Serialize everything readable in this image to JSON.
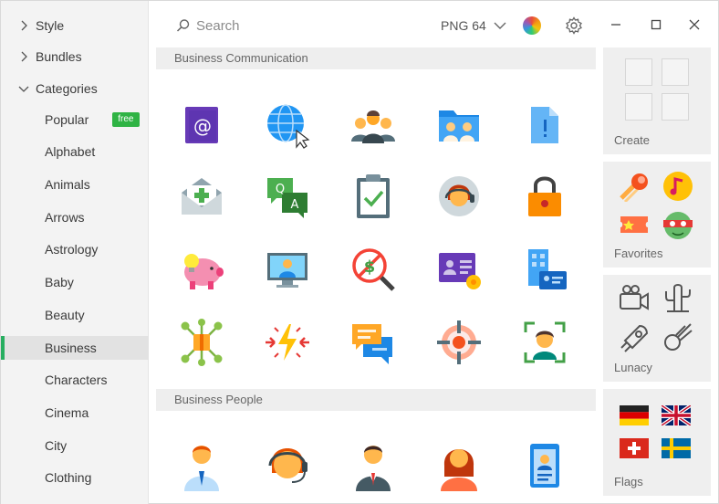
{
  "sidebar": {
    "top": [
      {
        "label": "Style",
        "expanded": false
      },
      {
        "label": "Bundles",
        "expanded": false
      },
      {
        "label": "Categories",
        "expanded": true
      }
    ],
    "categories": [
      {
        "label": "Popular",
        "badge": "free"
      },
      {
        "label": "Alphabet"
      },
      {
        "label": "Animals"
      },
      {
        "label": "Arrows"
      },
      {
        "label": "Astrology"
      },
      {
        "label": "Baby"
      },
      {
        "label": "Beauty"
      },
      {
        "label": "Business",
        "active": true
      },
      {
        "label": "Characters"
      },
      {
        "label": "Cinema"
      },
      {
        "label": "City"
      },
      {
        "label": "Clothing"
      }
    ]
  },
  "toolbar": {
    "search_placeholder": "Search",
    "format_label": "PNG 64"
  },
  "sections": [
    {
      "title": "Business Communication",
      "icons": [
        "email-at-icon",
        "globe-cursor-icon",
        "team-icon",
        "shared-folder-icon",
        "document-important-icon",
        "envelope-add-icon",
        "qa-chat-icon",
        "clipboard-check-icon",
        "customer-support-icon",
        "padlock-icon",
        "piggy-bank-idea-icon",
        "video-call-icon",
        "no-money-search-icon",
        "business-card-icon",
        "office-building-card-icon",
        "network-box-icon",
        "energy-collision-icon",
        "chat-bubbles-icon",
        "target-icon",
        "face-scan-icon"
      ]
    },
    {
      "title": "Business People",
      "icons": [
        "businessman-icon",
        "operator-headset-icon",
        "manager-icon",
        "businesswoman-icon",
        "employee-badge-icon"
      ]
    }
  ],
  "panels": [
    {
      "label": "Create"
    },
    {
      "label": "Favorites",
      "icons": [
        "comet-icon",
        "music-note-icon",
        "ticket-icon",
        "ninja-turtle-icon"
      ]
    },
    {
      "label": "Lunacy",
      "icons": [
        "video-camera-icon",
        "cactus-icon",
        "rocket-icon",
        "comet-outline-icon"
      ]
    },
    {
      "label": "Flags",
      "icons": [
        "flag-germany-icon",
        "flag-uk-icon",
        "flag-switzerland-icon",
        "flag-sweden-icon"
      ]
    }
  ],
  "colors": {
    "accent": "#27ae60",
    "badge": "#2fb344",
    "sidebar_bg": "#f3f3f3",
    "panel_bg": "#efefef"
  }
}
